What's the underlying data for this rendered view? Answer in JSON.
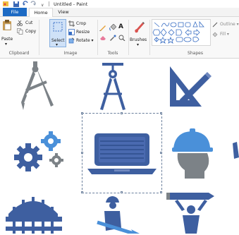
{
  "window": {
    "title": "Untitled - Paint"
  },
  "quick_access": {
    "dropdown_glyph": "∨"
  },
  "tabs": [
    {
      "label": "File"
    },
    {
      "label": "Home"
    },
    {
      "label": "View"
    }
  ],
  "ribbon": {
    "clipboard": {
      "paste": "Paste",
      "cut": "Cut",
      "copy": "Copy",
      "group": "Clipboard"
    },
    "image": {
      "select": "Select",
      "crop": "Crop",
      "resize": "Resize",
      "rotate": "Rotate ▾",
      "group": "Image"
    },
    "tools": {
      "text_tool": "A",
      "group": "Tools"
    },
    "brushes": {
      "label": "Brushes"
    },
    "shapes": {
      "outline": "Outline ▾",
      "fill": "Fill ▾",
      "group": "Shapes"
    }
  },
  "colors": {
    "file_tab": "#1c6ac4",
    "icon_blue": "#3e5fa0",
    "icon_gray": "#7c8287",
    "hat_blue": "#4a90d9"
  },
  "icons": [
    "compass-gray-icon",
    "drafting-compass-icon",
    "set-square-pencil-icon",
    "gears-icon",
    "laptop-icon",
    "engineer-hardhat-icon",
    "bridge-icon",
    "worker-shovel-icon",
    "person-lifting-pencil-icon"
  ]
}
